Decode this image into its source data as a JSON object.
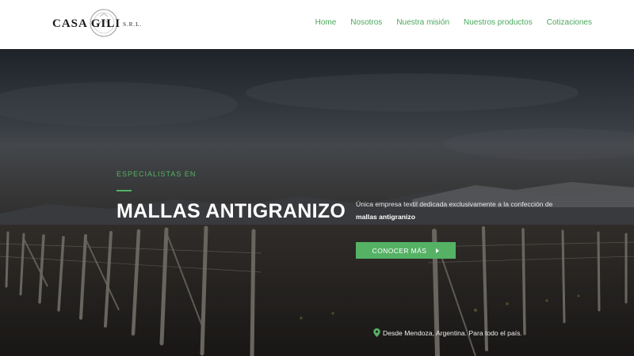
{
  "brand": {
    "name": "CASA GILI",
    "suffix": "S.R.L."
  },
  "nav": {
    "items": [
      "Home",
      "Nosotros",
      "Nuestra misión",
      "Nuestros productos",
      "Cotizaciones"
    ]
  },
  "hero": {
    "kicker": "ESPECIALISTAS EN",
    "title": "MALLAS ANTIGRANIZO",
    "description": "Única empresa textil dedicada exclusivamente a la confección de",
    "description_strong": "mallas antigranizo",
    "cta_label": "CONOCER MÁS",
    "location": "Desde Mendoza, Argentina. Para todo el país."
  },
  "icons": {
    "logo": "casa-gili-seal-logo",
    "cta": "caret-right-icon",
    "location": "map-pin-icon"
  },
  "colors": {
    "accent": "#55b265",
    "nav_link": "#4aa75c",
    "header_bg": "#ffffff",
    "hero_text": "#ffffff"
  }
}
